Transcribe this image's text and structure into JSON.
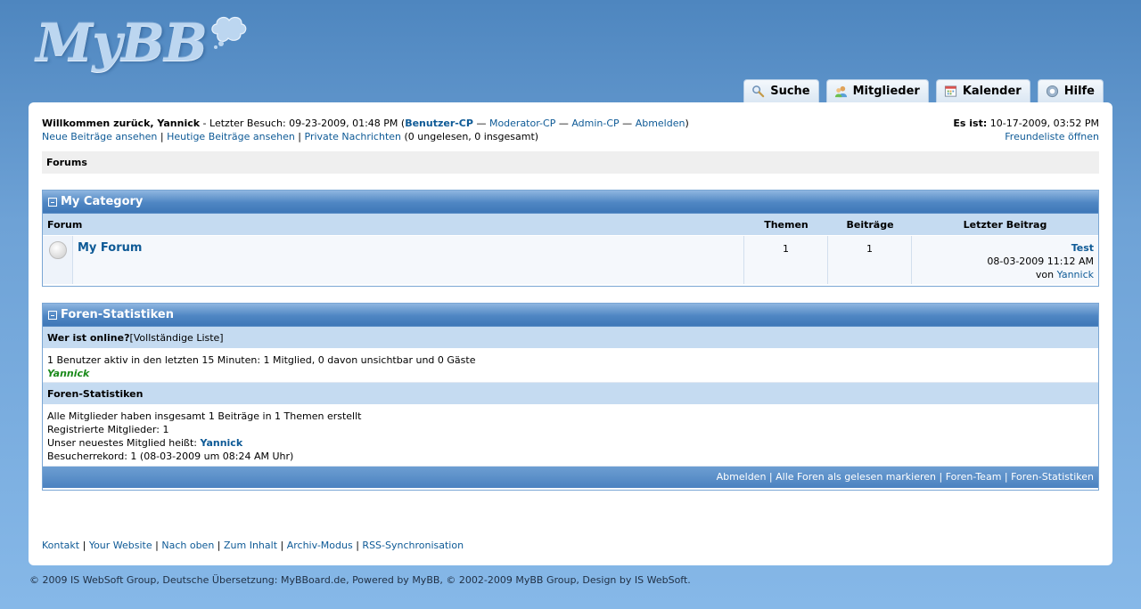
{
  "logo": {
    "text": "MyBB"
  },
  "tabs": [
    {
      "label": "Suche",
      "icon": "search-icon"
    },
    {
      "label": "Mitglieder",
      "icon": "members-icon"
    },
    {
      "label": "Kalender",
      "icon": "calendar-icon"
    },
    {
      "label": "Hilfe",
      "icon": "help-icon"
    }
  ],
  "welcome": {
    "greeting": "Willkommen zurück, Yannick",
    "last_visit": " - Letzter Besuch: 09-23-2009, 01:48 PM (",
    "user_cp": "Benutzer-CP",
    "sep": " — ",
    "mod_cp": "Moderator-CP",
    "admin_cp": "Admin-CP",
    "logout": "Abmelden",
    "close_paren": ")",
    "new_posts": "Neue Beiträge ansehen",
    "today_posts": "Heutige Beiträge ansehen",
    "private_messages": "Private Nachrichten",
    "pm_counts": " (0 ungelesen, 0 insgesamt)",
    "pipe": " | "
  },
  "clock": {
    "label": "Es ist:",
    "time": " 10-17-2009, 03:52 PM",
    "buddylist": "Freundeliste öffnen"
  },
  "breadcrumb": {
    "label": "Forums"
  },
  "category": {
    "title": "My Category",
    "columns": {
      "forum": "Forum",
      "threads": "Themen",
      "posts": "Beiträge",
      "lastpost": "Letzter Beitrag"
    },
    "forums": [
      {
        "name": "My Forum",
        "threads": "1",
        "posts": "1",
        "last_title": "Test",
        "last_date": "08-03-2009 11:12 AM",
        "last_by": "von ",
        "last_user": "Yannick"
      }
    ]
  },
  "stats": {
    "title": "Foren-Statistiken",
    "online_header": "Wer ist online?",
    "online_full_list": " [Vollständige Liste]",
    "online_text": "1 Benutzer aktiv in den letzten 15 Minuten: 1 Mitglied, 0 davon unsichtbar und 0 Gäste",
    "online_user": "Yannick",
    "stats_header": "Foren-Statistiken",
    "line1": "Alle Mitglieder haben insgesamt 1 Beiträge in 1 Themen erstellt",
    "line2": "Registrierte Mitglieder: 1",
    "line3_prefix": "Unser neuestes Mitglied heißt: ",
    "newest_member": "Yannick",
    "line4": "Besucherrekord: 1 (08-03-2009 um 08:24 AM Uhr)",
    "footer_links": [
      "Abmelden",
      "Alle Foren als gelesen markieren",
      "Foren-Team",
      "Foren-Statistiken"
    ]
  },
  "bottom_links": [
    "Kontakt",
    "Your Website",
    "Nach oben",
    "Zum Inhalt",
    "Archiv-Modus",
    "RSS-Synchronisation"
  ],
  "copyright": "© 2009 IS WebSoft Group, Deutsche Übersetzung: MyBBoard.de, Powered by MyBB, © 2002-2009 MyBB Group, Design by IS WebSoft.",
  "colors": {
    "background": "#6ea2d6",
    "header_bar": "#4f86c3",
    "category_row": "#c5dbf1",
    "link": "#0e5a96",
    "online_user": "#1a8a1a"
  }
}
